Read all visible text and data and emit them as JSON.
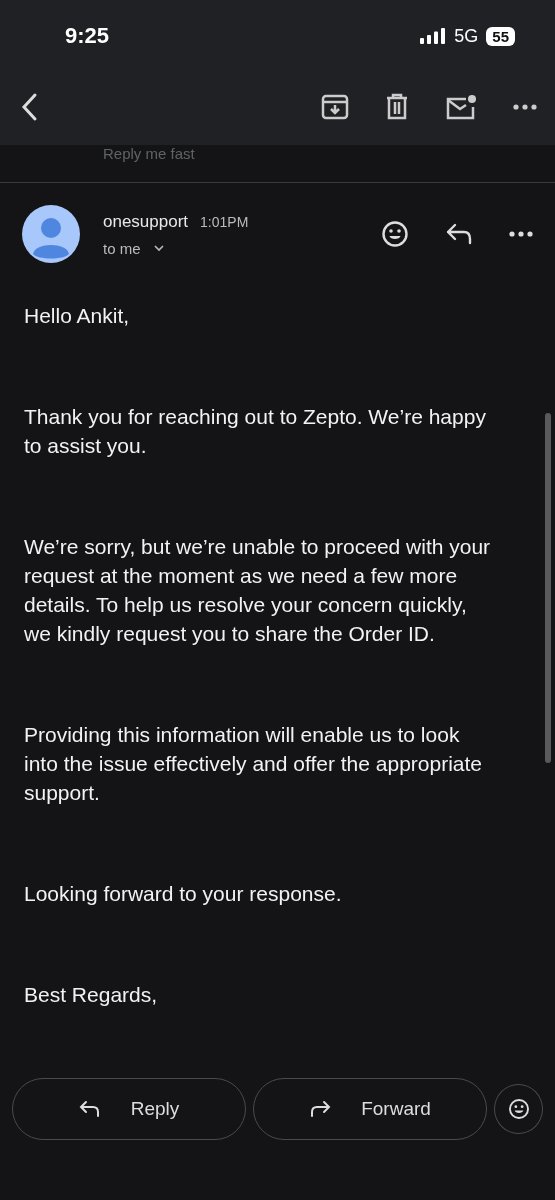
{
  "status_bar": {
    "time": "9:25",
    "network": "5G",
    "battery": "55"
  },
  "behind_header": {
    "preview": "Reply me fast"
  },
  "message": {
    "sender": "onesupport",
    "time": "1:01PM",
    "recipient": "to me",
    "paragraphs": [
      "Hello Ankit,",
      "Thank you for reaching out to Zepto. We’re happy to assist you.",
      "We’re sorry, but we’re unable to proceed with your request at the moment as we need a few more details. To help us resolve your concern quickly, we kindly request you to share the Order ID.",
      "Providing this information will enable us to look into the issue effectively and offer the appropriate support.",
      "Looking forward to your response.",
      "Best Regards,"
    ]
  },
  "actions": [
    {
      "kind": "reply",
      "label": "Reply"
    },
    {
      "kind": "forward",
      "label": "Forward"
    },
    {
      "kind": "emoji"
    }
  ]
}
